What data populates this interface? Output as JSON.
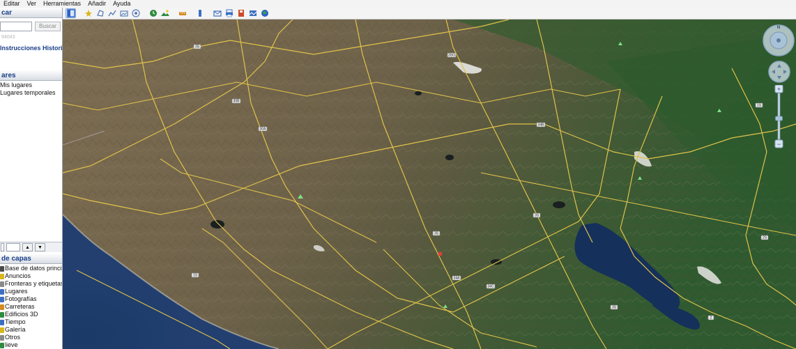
{
  "menu": {
    "items": [
      {
        "label": "Editar"
      },
      {
        "label": "Ver"
      },
      {
        "label": "Herramientas"
      },
      {
        "label": "Añadir"
      },
      {
        "label": "Ayuda"
      }
    ]
  },
  "toolbar": {
    "buttons": [
      {
        "icon": "sidebar-toggle-icon",
        "color": "#2a63c7"
      },
      {
        "icon": "placemark-icon",
        "color": "#d9b61c"
      },
      {
        "icon": "polygon-icon",
        "color": "#5a7fb8"
      },
      {
        "icon": "path-icon",
        "color": "#5a7fb8"
      },
      {
        "icon": "image-overlay-icon",
        "color": "#5a7fb8"
      },
      {
        "icon": "record-tour-icon",
        "color": "#5a7fb8"
      },
      {
        "icon": "historical-imagery-icon",
        "color": "#2e8b3d"
      },
      {
        "icon": "sunlight-icon",
        "color": "#2e8b3d"
      },
      {
        "icon": "ruler-icon",
        "color": "#d48a1e"
      },
      {
        "icon": "sky-switch-icon",
        "color": "#3c6fc2"
      },
      {
        "icon": "email-icon",
        "color": "#3c6fc2"
      },
      {
        "icon": "print-icon",
        "color": "#3c6fc2"
      },
      {
        "icon": "save-image-icon",
        "color": "#cc4a2a"
      },
      {
        "icon": "view-maps-icon",
        "color": "#3c6fc2"
      },
      {
        "icon": "earth-icon",
        "color": "#2a63c7"
      }
    ]
  },
  "sidebar": {
    "search": {
      "header": "car",
      "button_label": "Buscar",
      "hint": "94043",
      "tabs": "Instrucciones Historial"
    },
    "places": {
      "header": "ares",
      "items": [
        {
          "label": "Mis lugares"
        },
        {
          "label": "Lugares temporales"
        }
      ]
    },
    "layers": {
      "header": "de capas",
      "items": [
        {
          "label": "Base de datos principal",
          "icon_color": "#4a4a4a"
        },
        {
          "label": "Anuncios",
          "icon_color": "#d9b61c"
        },
        {
          "label": "Fronteras y etiquetas",
          "icon_color": "#8a8a8a"
        },
        {
          "label": "Lugares",
          "icon_color": "#3c6fc2"
        },
        {
          "label": "Fotografías",
          "icon_color": "#3c6fc2"
        },
        {
          "label": "Carreteras",
          "icon_color": "#d48a1e"
        },
        {
          "label": "Edificios 3D",
          "icon_color": "#2e8b3d"
        },
        {
          "label": "Tiempo",
          "icon_color": "#3c6fc2"
        },
        {
          "label": "Galería",
          "icon_color": "#d9b61c"
        },
        {
          "label": "Otros",
          "icon_color": "#8a8a8a"
        },
        {
          "label": "lieve",
          "icon_color": "#2e8b3d"
        }
      ]
    }
  },
  "map": {
    "road_labels": [
      {
        "text": "3S"
      },
      {
        "text": "30B"
      },
      {
        "text": "30A"
      },
      {
        "text": "3SG"
      },
      {
        "text": "34B"
      },
      {
        "text": "3S"
      },
      {
        "text": "34A"
      },
      {
        "text": "34C"
      },
      {
        "text": "1S"
      },
      {
        "text": "3S"
      },
      {
        "text": "1S"
      },
      {
        "text": "2S"
      },
      {
        "text": "3S"
      },
      {
        "text": "2"
      }
    ]
  },
  "navigation": {
    "compass_label": "N"
  }
}
